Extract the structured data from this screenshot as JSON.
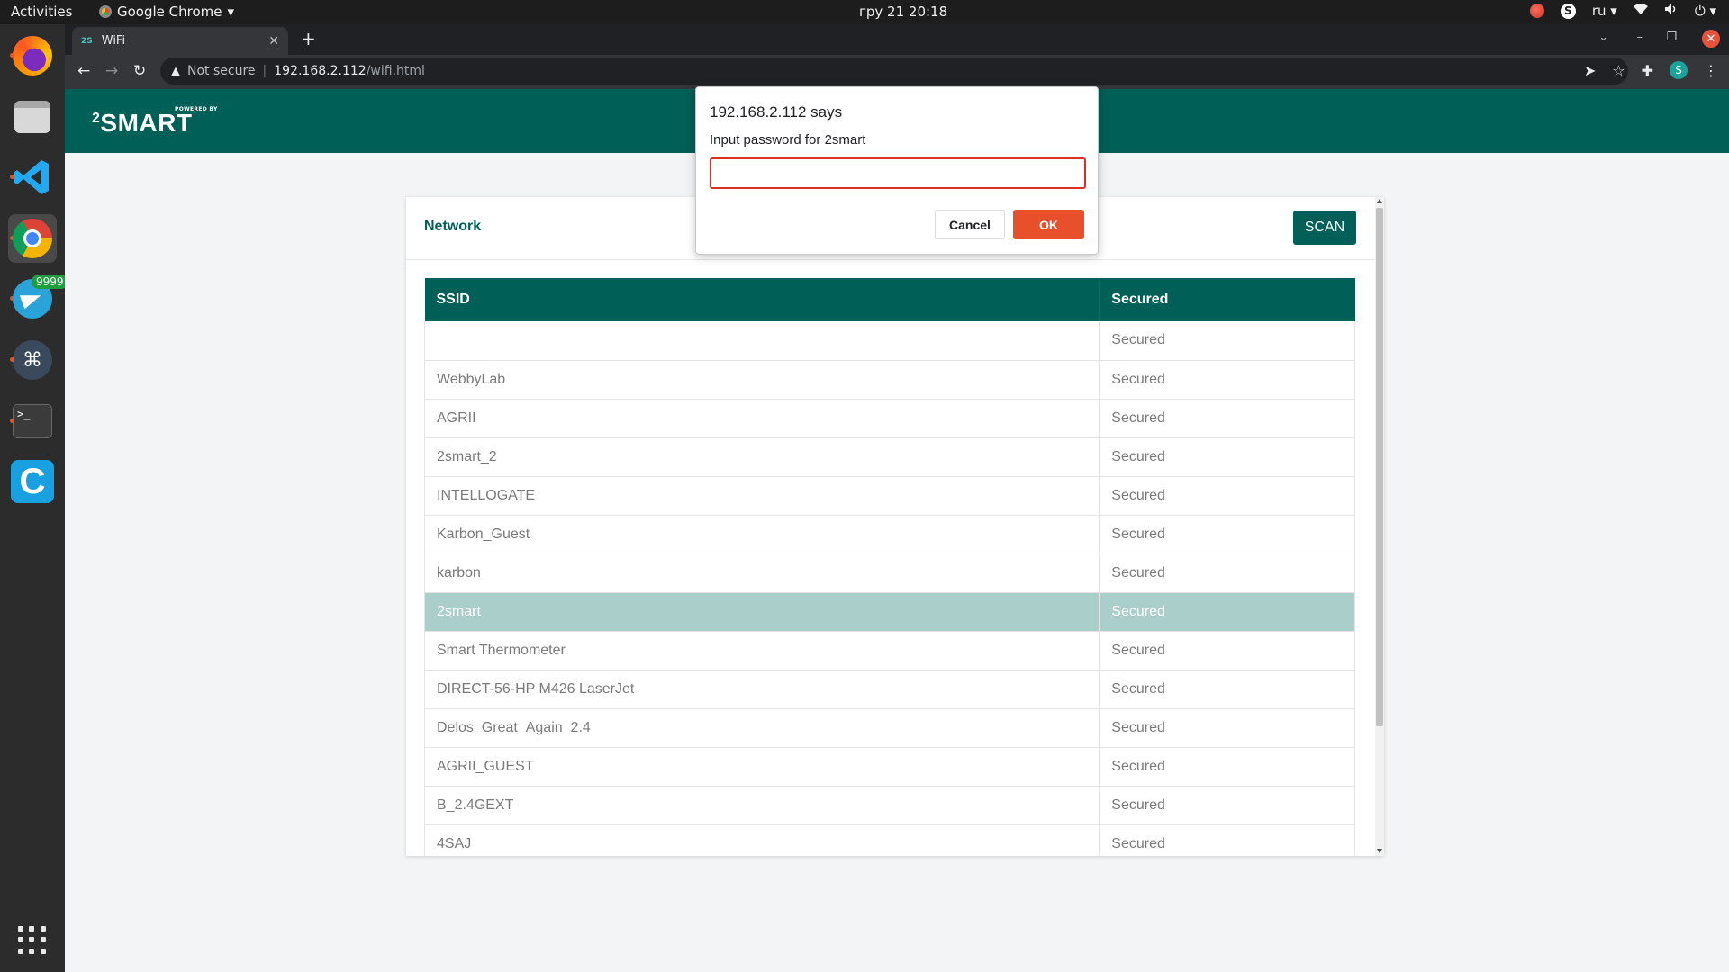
{
  "os": {
    "activities": "Activities",
    "app_name": "Google Chrome",
    "clock": "гру 21  20:18",
    "lang": "ru"
  },
  "dock": {
    "telegram_badge": "9999"
  },
  "browser": {
    "tab_title": "WiFi",
    "tab_favicon": "2S",
    "security_label": "Not secure",
    "url_host": "192.168.2.112",
    "url_path": "/wifi.html",
    "profile_initial": "S"
  },
  "app": {
    "logo_text": "SMART",
    "logo_sup": "2",
    "powered_by": "POWERED BY"
  },
  "network": {
    "title": "Network",
    "scan_label": "SCAN",
    "columns": [
      "SSID",
      "Secured"
    ],
    "rows": [
      {
        "ssid": "",
        "secured": "Secured"
      },
      {
        "ssid": "WebbyLab",
        "secured": "Secured"
      },
      {
        "ssid": "AGRII",
        "secured": "Secured"
      },
      {
        "ssid": "2smart_2",
        "secured": "Secured"
      },
      {
        "ssid": "INTELLOGATE",
        "secured": "Secured"
      },
      {
        "ssid": "Karbon_Guest",
        "secured": "Secured"
      },
      {
        "ssid": "karbon",
        "secured": "Secured"
      },
      {
        "ssid": "2smart",
        "secured": "Secured"
      },
      {
        "ssid": "Smart Thermometer",
        "secured": "Secured"
      },
      {
        "ssid": "DIRECT-56-HP M426 LaserJet",
        "secured": "Secured"
      },
      {
        "ssid": "Delos_Great_Again_2.4",
        "secured": "Secured"
      },
      {
        "ssid": "AGRII_GUEST",
        "secured": "Secured"
      },
      {
        "ssid": "B_2.4GEXT",
        "secured": "Secured"
      },
      {
        "ssid": "4SAJ",
        "secured": "Secured"
      }
    ]
  },
  "dialog": {
    "title": "192.168.2.112 says",
    "message": "Input password for 2smart",
    "input_value": "",
    "cancel_label": "Cancel",
    "ok_label": "OK"
  },
  "colors": {
    "brand": "#005f56",
    "selected_row": "#aacfcb",
    "ok_button": "#e8502b",
    "input_border": "#d93025"
  }
}
